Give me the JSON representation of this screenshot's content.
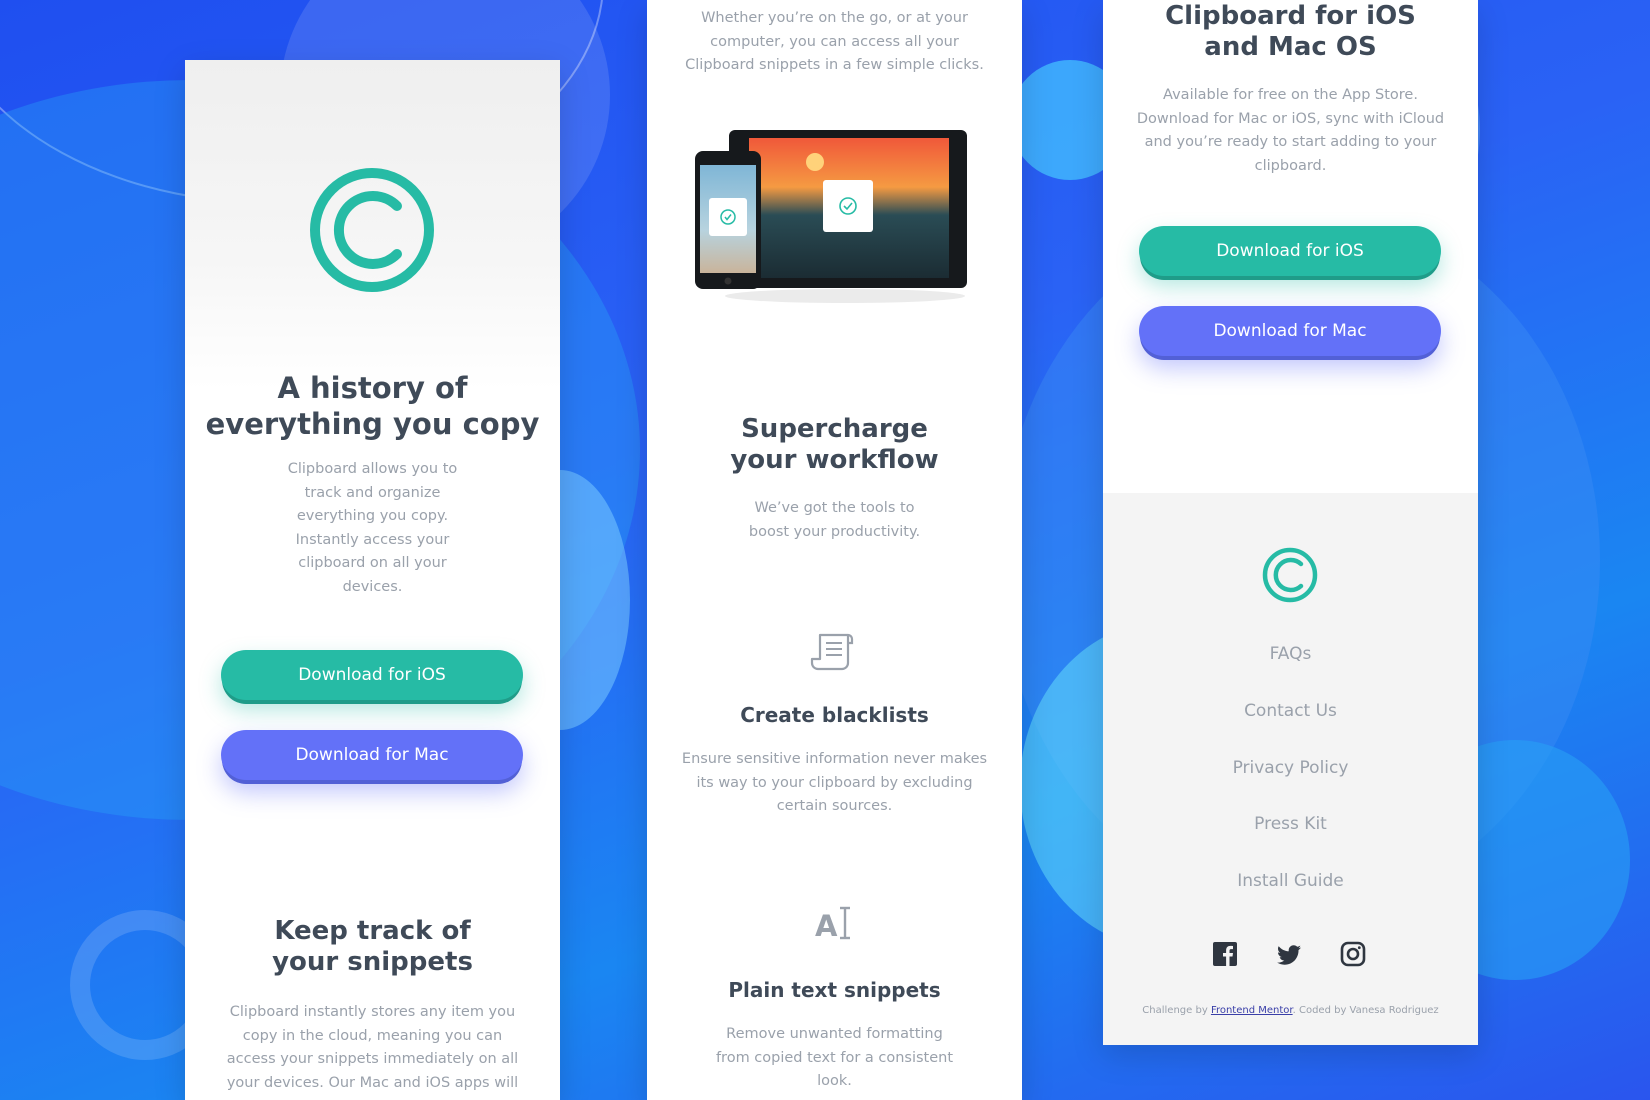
{
  "panel1": {
    "hero_title": "A history of everything you copy",
    "hero_desc": "Clipboard allows you to track and organize everything you copy. Instantly access your clipboard on all your devices.",
    "btn_ios": "Download for iOS",
    "btn_mac": "Download for Mac",
    "section_title": "Keep track of your snippets",
    "section_desc": "Clipboard instantly stores any item you copy in the cloud, meaning you can access your snippets immediately on all your devices. Our Mac and iOS apps will"
  },
  "panel2": {
    "intro_desc": "Whether you’re on the go, or at your computer, you can access all your Clipboard snippets in a few simple clicks.",
    "section_title": "Supercharge your workflow",
    "section_desc": "We’ve got the tools to boost your productivity.",
    "feature1_title": "Create blacklists",
    "feature1_desc": "Ensure sensitive information never makes its way to your clipboard by excluding certain sources.",
    "feature2_title": "Plain text snippets",
    "feature2_desc": "Remove unwanted formatting from copied text for a consistent look."
  },
  "panel3": {
    "cta_title": "Clipboard for iOS and Mac OS",
    "cta_desc": "Available for free on the App Store. Download for Mac or iOS, sync with iCloud and you’re ready to start adding to your clipboard.",
    "btn_ios": "Download for iOS",
    "btn_mac": "Download for Mac",
    "footer_links": [
      "FAQs",
      "Contact Us",
      "Privacy Policy",
      "Press Kit",
      "Install Guide"
    ],
    "social_icons": [
      "facebook-icon",
      "twitter-icon",
      "instagram-icon"
    ],
    "credit_prefix": "Challenge by",
    "credit_link": "Frontend Mentor",
    "credit_suffix": ". Coded by Vanesa Rodriguez"
  },
  "colors": {
    "accent_teal": "#26bba5",
    "accent_blue": "#6371f8",
    "heading": "#3f4a58",
    "body_text": "#9aa1ab",
    "background": "#2a62f5"
  }
}
